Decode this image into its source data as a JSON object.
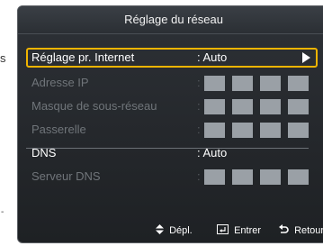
{
  "side": {
    "letter": "s",
    "mark": "-"
  },
  "panel": {
    "title": "Réglage du réseau"
  },
  "rows": [
    {
      "label": "Réglage pr. Internet",
      "value": ": Auto",
      "state": "selected"
    },
    {
      "label": "Adresse IP",
      "value": ":",
      "state": "disabled"
    },
    {
      "label": "Masque de sous-réseau",
      "value": ":",
      "state": "disabled"
    },
    {
      "label": "Passerelle",
      "value": ":",
      "state": "disabled"
    },
    {
      "label": "DNS",
      "value": ": Auto",
      "state": "active"
    },
    {
      "label": "Serveur DNS",
      "value": ":",
      "state": "disabled"
    }
  ],
  "footer": {
    "move_label": "Dépl.",
    "enter_label": "Entrer",
    "return_label": "Retour",
    "move_icon": "updown-arrows-icon",
    "enter_icon": "enter-key-icon",
    "return_icon": "return-arrow-icon"
  },
  "colors": {
    "selection_border": "#f0b400",
    "panel_bg": "#24272b",
    "disabled_text": "#70757a",
    "field_box": "#9aa0a6"
  }
}
